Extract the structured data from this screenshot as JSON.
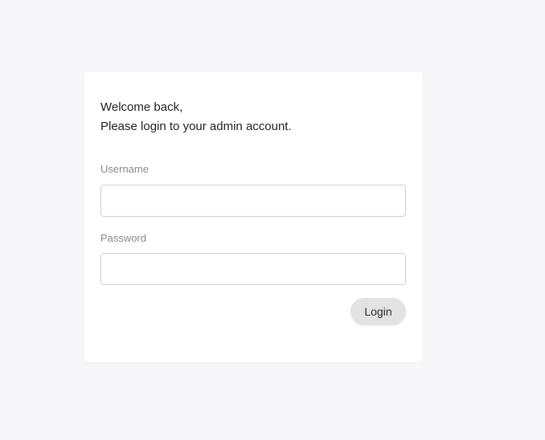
{
  "login": {
    "greeting_line1": "Welcome back,",
    "greeting_line2": "Please login to your admin account.",
    "username_label": "Username",
    "username_value": "",
    "password_label": "Password",
    "password_value": "",
    "login_button_label": "Login"
  },
  "colors": {
    "page_background": "#f7f7f9",
    "card_background": "#ffffff",
    "button_background": "#e3e3e3",
    "label_text": "#8a8a8a",
    "body_text": "#1f1f1f"
  }
}
